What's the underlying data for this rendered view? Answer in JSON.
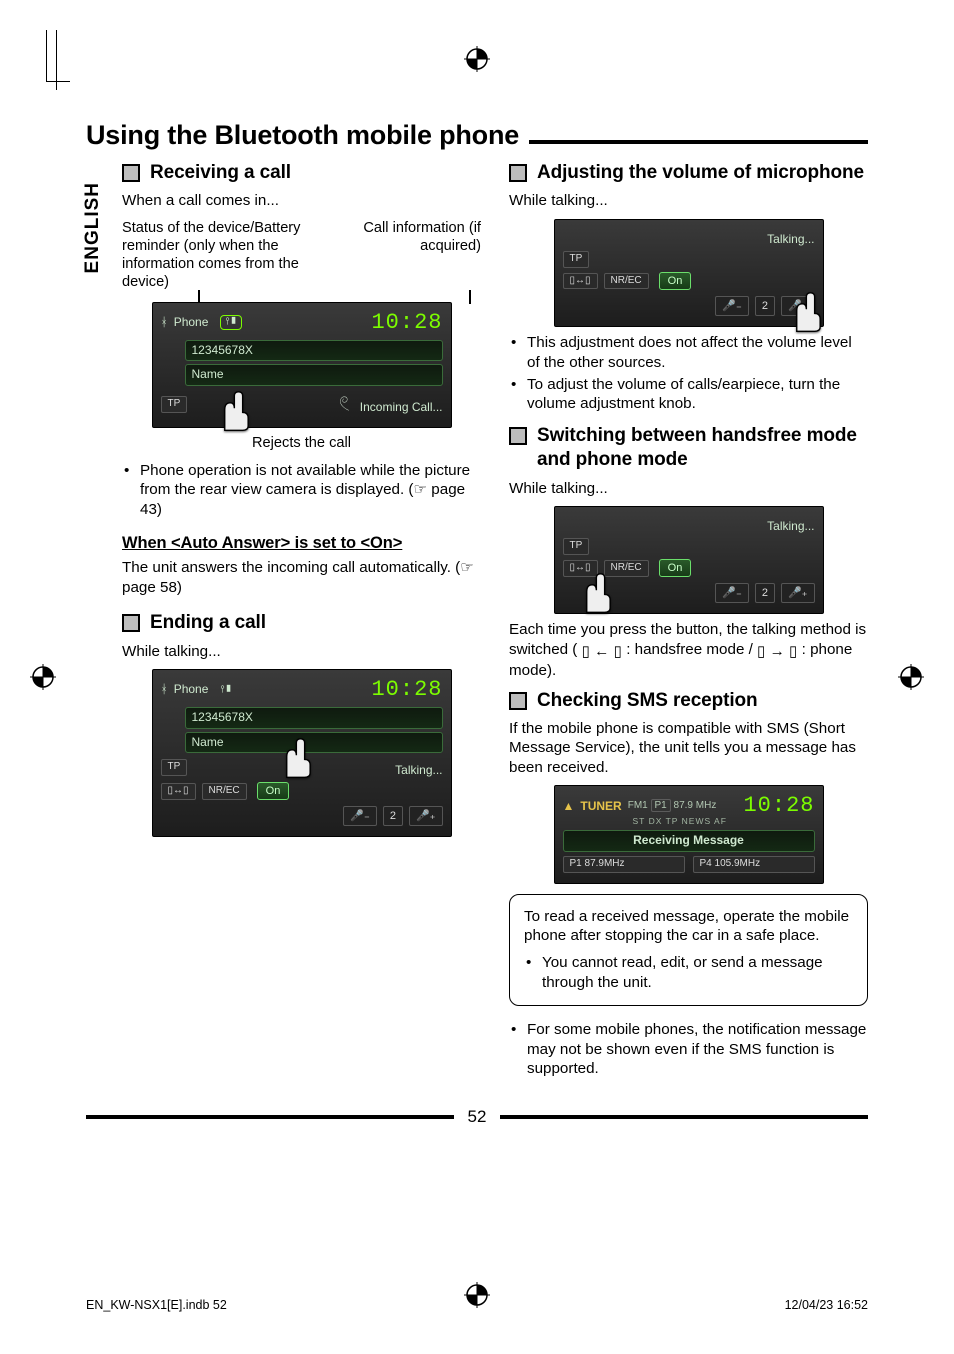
{
  "lang_tab": "ENGLISH",
  "title": "Using the Bluetooth mobile phone",
  "page_number": "52",
  "footer_left": "EN_KW-NSX1[E].indb   52",
  "footer_right": "12/04/23   16:52",
  "left": {
    "sec1_title": "Receiving a call",
    "intro": "When a call comes in...",
    "label_status": "Status of the device/Battery reminder (only when the information comes from the device)",
    "label_callinfo": "Call information (if acquired)",
    "rejects": "Rejects the call",
    "bullet1": "Phone operation is not available while the picture from the rear view camera is displayed. (☞ page 43)",
    "link_head": "When <Auto Answer> is set to <On>",
    "auto_ans": "The unit answers the incoming call automatically. (☞ page 58)",
    "sec2_title": "Ending a call",
    "while_talking": "While talking...",
    "ss1": {
      "src": "Phone",
      "num": "12345678X",
      "name": "Name",
      "clock": "10:28",
      "status": "Incoming Call...",
      "tp": "TP"
    },
    "ss2": {
      "src": "Phone",
      "num": "12345678X",
      "name": "Name",
      "clock": "10:28",
      "status": "Talking...",
      "tp": "TP",
      "nrec": "NR/EC",
      "on": "On",
      "vol": "2"
    }
  },
  "right": {
    "sec1_title": "Adjusting the volume of microphone",
    "while_talking": "While talking...",
    "ss1": {
      "status": "Talking...",
      "tp": "TP",
      "nrec": "NR/EC",
      "on": "On",
      "vol": "2"
    },
    "bullet1": "This adjustment does not affect the volume level of the other sources.",
    "bullet2": "To adjust the volume of calls/earpiece, turn the volume adjustment knob.",
    "sec2_title": "Switching between handsfree mode and phone mode",
    "ss2": {
      "status": "Talking...",
      "tp": "TP",
      "nrec": "NR/EC",
      "on": "On",
      "vol": "2"
    },
    "switch_p_a": "Each time you press the button, the talking method is switched (",
    "switch_hf": " : handsfree mode / ",
    "switch_ph": " : phone mode).",
    "sec3_title": "Checking SMS reception",
    "sms_intro": "If the mobile phone is compatible with SMS (Short Message Service), the unit tells you a message has been received.",
    "ss3": {
      "tuner": "TUNER",
      "band": "FM1",
      "bandfreq": "87.9 MHz",
      "flags": "ST   DX   TP   NEWS   AF",
      "clock": "10:28",
      "msg": "Receiving Message",
      "p1": "P1 87.9MHz",
      "p4": "P4 105.9MHz"
    },
    "note1": "To read a received message, operate the mobile phone after stopping the car in a safe place.",
    "note_b1": "You cannot read, edit, or send a message through the unit.",
    "after_b1": "For some mobile phones, the notification message may not be shown even if the SMS function is supported."
  }
}
